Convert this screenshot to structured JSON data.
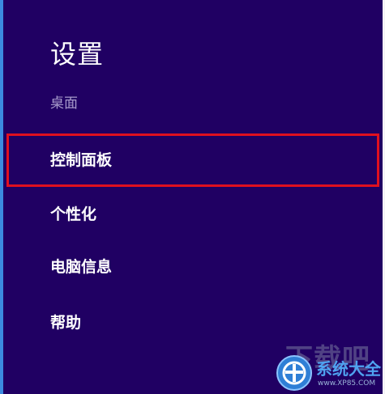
{
  "panel": {
    "title": "设置",
    "subtitle": "桌面"
  },
  "menu": {
    "items": [
      {
        "label": "控制面板",
        "highlighted": true
      },
      {
        "label": "个性化",
        "highlighted": false
      },
      {
        "label": "电脑信息",
        "highlighted": false
      },
      {
        "label": "帮助",
        "highlighted": false
      }
    ]
  },
  "watermark": {
    "text": "下载吧",
    "brand": "系统大全",
    "site": "www.XP85.COM"
  },
  "colors": {
    "background": "#200063",
    "highlight_border": "#e0101f",
    "accent": "#3c8be0",
    "subtitle": "#a79bcb"
  }
}
